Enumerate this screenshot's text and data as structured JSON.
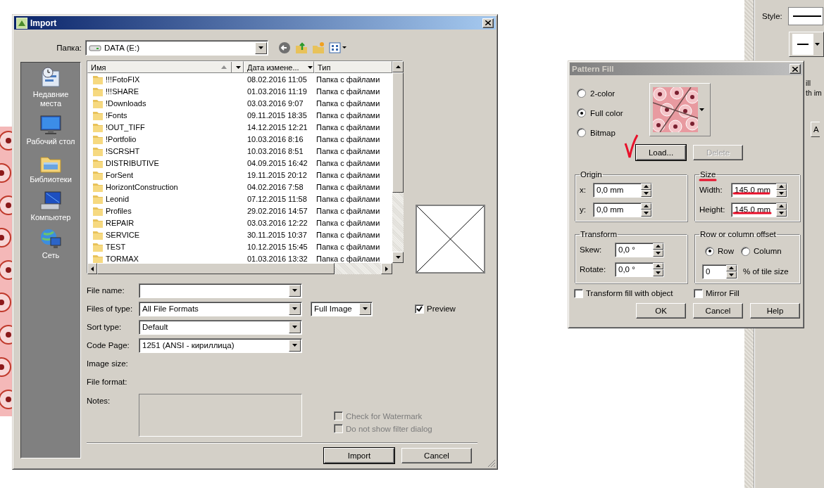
{
  "import_dialog": {
    "title": "Import",
    "folder_label": "Папка:",
    "folder": "DATA (E:)",
    "places": [
      {
        "label": "Недавние места",
        "kind": "recent"
      },
      {
        "label": "Рабочий стол",
        "kind": "desktop"
      },
      {
        "label": "Библиотеки",
        "kind": "libraries"
      },
      {
        "label": "Компьютер",
        "kind": "computer"
      },
      {
        "label": "Сеть",
        "kind": "network"
      }
    ],
    "columns": [
      {
        "label": "Имя",
        "sorted": true
      },
      {
        "label": "Дата измене...",
        "sorted": false
      },
      {
        "label": "Тип",
        "sorted": false
      }
    ],
    "rows": [
      {
        "name": "!!!FotoFIX",
        "date": "08.02.2016 11:05",
        "type": "Папка с файлами"
      },
      {
        "name": "!!!SHARE",
        "date": "01.03.2016 11:19",
        "type": "Папка с файлами"
      },
      {
        "name": "!Downloads",
        "date": "03.03.2016 9:07",
        "type": "Папка с файлами"
      },
      {
        "name": "!Fonts",
        "date": "09.11.2015 18:35",
        "type": "Папка с файлами"
      },
      {
        "name": "!OUT_TIFF",
        "date": "14.12.2015 12:21",
        "type": "Папка с файлами"
      },
      {
        "name": "!Portfolio",
        "date": "10.03.2016 8:16",
        "type": "Папка с файлами"
      },
      {
        "name": "!SCRSHT",
        "date": "10.03.2016 8:51",
        "type": "Папка с файлами"
      },
      {
        "name": "DISTRIBUTIVE",
        "date": "04.09.2015 16:42",
        "type": "Папка с файлами"
      },
      {
        "name": "ForSent",
        "date": "19.11.2015 20:12",
        "type": "Папка с файлами"
      },
      {
        "name": "HorizontConstruction",
        "date": "04.02.2016 7:58",
        "type": "Папка с файлами"
      },
      {
        "name": "Leonid",
        "date": "07.12.2015 11:58",
        "type": "Папка с файлами"
      },
      {
        "name": "Profiles",
        "date": "29.02.2016 14:57",
        "type": "Папка с файлами"
      },
      {
        "name": "REPAIR",
        "date": "03.03.2016 12:22",
        "type": "Папка с файлами"
      },
      {
        "name": "SERVICE",
        "date": "30.11.2015 10:37",
        "type": "Папка с файлами"
      },
      {
        "name": "TEST",
        "date": "10.12.2015 15:45",
        "type": "Папка с файлами"
      },
      {
        "name": "TORMAX",
        "date": "01.03.2016 13:32",
        "type": "Папка с файлами"
      }
    ],
    "fields": [
      {
        "label": "File name:",
        "kind": "combo"
      },
      {
        "label": "Files of type:",
        "kind": "combo",
        "value": "All File Formats",
        "extra": "Full Image"
      },
      {
        "label": "Sort type:",
        "kind": "combo",
        "value": "Default"
      },
      {
        "label": "Code Page:",
        "kind": "combo",
        "value": "1251  (ANSI - кириллица)"
      },
      {
        "label": "Image size:",
        "kind": "info"
      },
      {
        "label": "File format:",
        "kind": "info"
      }
    ],
    "preview": {
      "label": "Preview",
      "checked": true
    },
    "notes_label": "Notes:",
    "options": [
      {
        "label": "Check for Watermark",
        "checked": false,
        "disabled": true
      },
      {
        "label": "Do not show filter dialog",
        "checked": false,
        "disabled": true
      }
    ],
    "buttons": [
      {
        "label": "Import",
        "default": true
      },
      {
        "label": "Cancel",
        "default": false
      }
    ]
  },
  "pattern_dialog": {
    "title": "Pattern Fill",
    "fill_types": [
      {
        "label": "2-color",
        "selected": false
      },
      {
        "label": "Full color",
        "selected": true
      },
      {
        "label": "Bitmap",
        "selected": false
      }
    ],
    "actions": [
      {
        "label": "Load...",
        "disabled": false
      },
      {
        "label": "Delete",
        "disabled": true
      }
    ],
    "origin": {
      "title": "Origin",
      "fields": [
        {
          "label": "x:",
          "value": "0,0 mm"
        },
        {
          "label": "y:",
          "value": "0,0 mm"
        }
      ]
    },
    "size": {
      "title": "Size",
      "fields": [
        {
          "label": "Width:",
          "value": "145,0 mm"
        },
        {
          "label": "Height:",
          "value": "145,0 mm"
        }
      ]
    },
    "transform": {
      "title": "Transform",
      "fields": [
        {
          "label": "Skew:",
          "value": "0,0 °"
        },
        {
          "label": "Rotate:",
          "value": "0,0 °"
        }
      ]
    },
    "offset": {
      "title": "Row or column offset",
      "options": [
        {
          "label": "Row",
          "selected": true
        },
        {
          "label": "Column",
          "selected": false
        }
      ],
      "value": "0",
      "suffix": "% of tile size"
    },
    "checks": [
      {
        "label": "Transform fill with object",
        "checked": false
      },
      {
        "label": "Mirror Fill",
        "checked": false
      }
    ],
    "buttons": [
      "OK",
      "Cancel",
      "Help"
    ]
  },
  "side_panel": {
    "style_label": "Style:",
    "texts": [
      "ill",
      "th im"
    ],
    "button": "A"
  }
}
